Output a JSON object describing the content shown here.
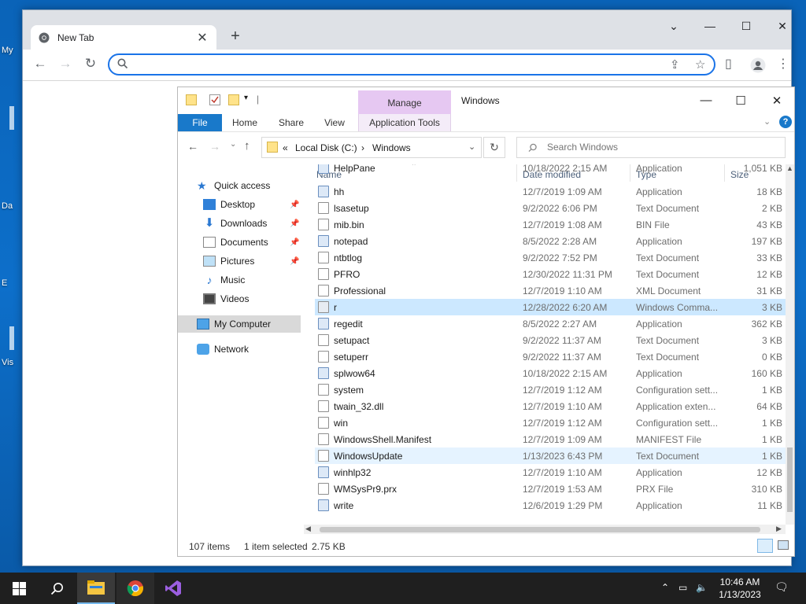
{
  "desktop": {
    "labels": [
      "My",
      "Da",
      "E",
      "Vis"
    ]
  },
  "browser": {
    "tab_title": "New Tab",
    "tab_close": "✕",
    "new_tab": "+",
    "min": "⌄",
    "minimize": "—",
    "maximize": "☐",
    "close": "✕",
    "omnibox_placeholder": ""
  },
  "explorer": {
    "manage_tab": "Manage",
    "window_title": "Windows",
    "ribbon": {
      "file": "File",
      "home": "Home",
      "share": "Share",
      "view": "View",
      "app_tools": "Application Tools"
    },
    "address": {
      "prefix": "«",
      "crumb1": "Local Disk (C:)",
      "sep": "›",
      "crumb2": "Windows"
    },
    "search_placeholder": "Search Windows",
    "nav": {
      "quick_access": "Quick access",
      "desktop": "Desktop",
      "downloads": "Downloads",
      "documents": "Documents",
      "pictures": "Pictures",
      "music": "Music",
      "videos": "Videos",
      "my_computer": "My Computer",
      "network": "Network"
    },
    "columns": {
      "name": "Name",
      "date": "Date modified",
      "type": "Type",
      "size": "Size"
    },
    "files": [
      {
        "name": "HelpPane",
        "date": "10/18/2022 2:15 AM",
        "type": "Application",
        "size": "1,051 KB"
      },
      {
        "name": "hh",
        "date": "12/7/2019 1:09 AM",
        "type": "Application",
        "size": "18 KB"
      },
      {
        "name": "lsasetup",
        "date": "9/2/2022 6:06 PM",
        "type": "Text Document",
        "size": "2 KB"
      },
      {
        "name": "mib.bin",
        "date": "12/7/2019 1:08 AM",
        "type": "BIN File",
        "size": "43 KB"
      },
      {
        "name": "notepad",
        "date": "8/5/2022 2:28 AM",
        "type": "Application",
        "size": "197 KB"
      },
      {
        "name": "ntbtlog",
        "date": "9/2/2022 7:52 PM",
        "type": "Text Document",
        "size": "33 KB"
      },
      {
        "name": "PFRO",
        "date": "12/30/2022 11:31 PM",
        "type": "Text Document",
        "size": "12 KB"
      },
      {
        "name": "Professional",
        "date": "12/7/2019 1:10 AM",
        "type": "XML Document",
        "size": "31 KB"
      },
      {
        "name": "r",
        "date": "12/28/2022 6:20 AM",
        "type": "Windows Comma...",
        "size": "3 KB"
      },
      {
        "name": "regedit",
        "date": "8/5/2022 2:27 AM",
        "type": "Application",
        "size": "362 KB"
      },
      {
        "name": "setupact",
        "date": "9/2/2022 11:37 AM",
        "type": "Text Document",
        "size": "3 KB"
      },
      {
        "name": "setuperr",
        "date": "9/2/2022 11:37 AM",
        "type": "Text Document",
        "size": "0 KB"
      },
      {
        "name": "splwow64",
        "date": "10/18/2022 2:15 AM",
        "type": "Application",
        "size": "160 KB"
      },
      {
        "name": "system",
        "date": "12/7/2019 1:12 AM",
        "type": "Configuration sett...",
        "size": "1 KB"
      },
      {
        "name": "twain_32.dll",
        "date": "12/7/2019 1:10 AM",
        "type": "Application exten...",
        "size": "64 KB"
      },
      {
        "name": "win",
        "date": "12/7/2019 1:12 AM",
        "type": "Configuration sett...",
        "size": "1 KB"
      },
      {
        "name": "WindowsShell.Manifest",
        "date": "12/7/2019 1:09 AM",
        "type": "MANIFEST File",
        "size": "1 KB"
      },
      {
        "name": "WindowsUpdate",
        "date": "1/13/2023 6:43 PM",
        "type": "Text Document",
        "size": "1 KB"
      },
      {
        "name": "winhlp32",
        "date": "12/7/2019 1:10 AM",
        "type": "Application",
        "size": "12 KB"
      },
      {
        "name": "WMSysPr9.prx",
        "date": "12/7/2019 1:53 AM",
        "type": "PRX File",
        "size": "310 KB"
      },
      {
        "name": "write",
        "date": "12/6/2019 1:29 PM",
        "type": "Application",
        "size": "11 KB"
      }
    ],
    "status": {
      "count": "107 items",
      "selected": "1 item selected",
      "size": "2.75 KB"
    }
  },
  "taskbar": {
    "time": "10:46 AM",
    "date": "1/13/2023"
  }
}
